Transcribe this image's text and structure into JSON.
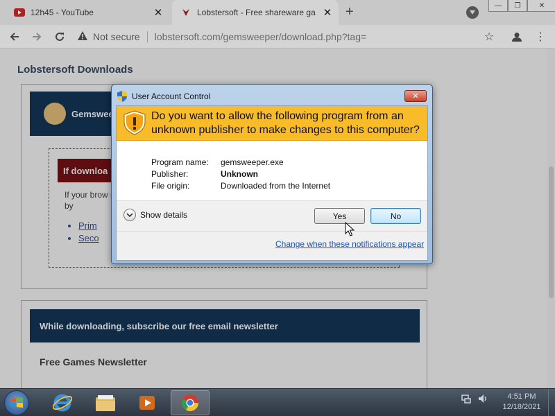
{
  "browser": {
    "tabs": [
      {
        "title": "12h45 - YouTube",
        "icon": "youtube-icon"
      },
      {
        "title": "Lobstersoft - Free shareware ga",
        "icon": "lobstersoft-icon"
      }
    ],
    "address": {
      "security_text": "Not secure",
      "url": "lobstersoft.com/gemsweeper/download.php?tag="
    }
  },
  "page": {
    "title": "Lobstersoft Downloads",
    "product_name": "Gemsweeper",
    "download_alert": "If downloa",
    "download_text": "If your brow manually by",
    "mirrors": [
      "Prim",
      "Seco"
    ],
    "newsletter_banner": "While downloading, subscribe our free email newsletter",
    "newsletter_title": "Free Games Newsletter"
  },
  "dialog": {
    "title": "User Account Control",
    "question": "Do you want to allow the following program from an unknown publisher to make changes to this computer?",
    "info": [
      {
        "label": "Program name:",
        "value": "gemsweeper.exe",
        "bold": false
      },
      {
        "label": "Publisher:",
        "value": "Unknown",
        "bold": true
      },
      {
        "label": "File origin:",
        "value": "Downloaded from the Internet",
        "bold": false
      }
    ],
    "show_details": "Show details",
    "yes": "Yes",
    "no": "No",
    "change_link": "Change when these notifications appear"
  },
  "taskbar": {
    "time": "4:51 PM",
    "date": "12/18/2021",
    "apps": [
      "internet-explorer-icon",
      "file-explorer-icon",
      "media-player-icon",
      "chrome-icon"
    ]
  },
  "colors": {
    "banner": "#f8bb2a",
    "navy": "#0f2b46",
    "link": "#1a56b8"
  }
}
